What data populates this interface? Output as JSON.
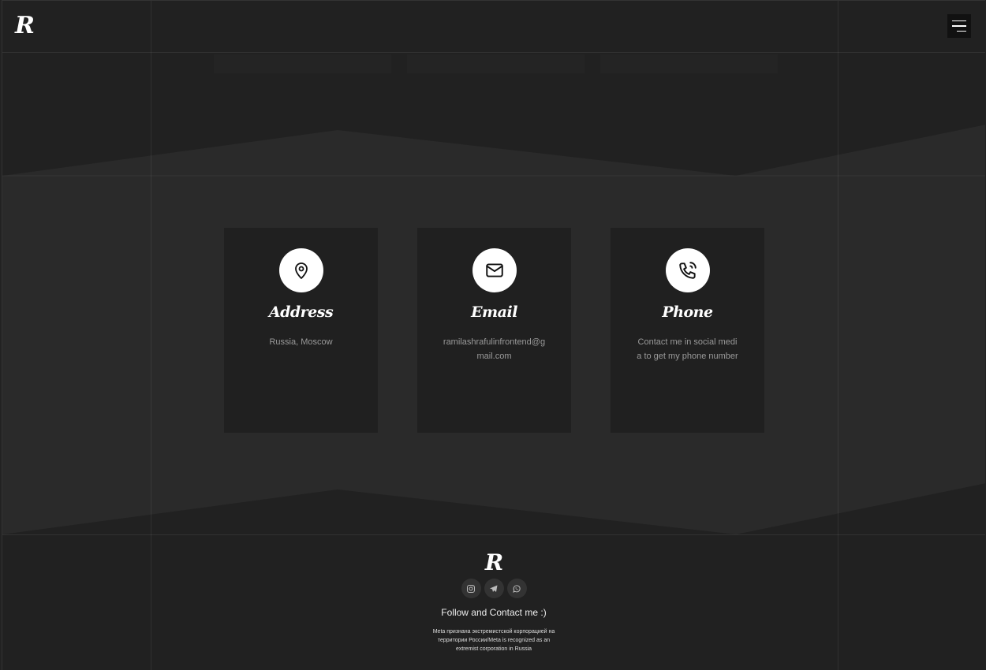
{
  "header": {
    "logo": "R",
    "menu_icon": "hamburger-icon"
  },
  "contact_cards": [
    {
      "icon": "map-pin-icon",
      "title": "Address",
      "text": "Russia, Moscow"
    },
    {
      "icon": "mail-icon",
      "title": "Email",
      "text": "ramilashrafulinfrontend@gmail.com"
    },
    {
      "icon": "phone-call-icon",
      "title": "Phone",
      "text": "Contact me in social media to get my phone number"
    }
  ],
  "footer": {
    "logo": "R",
    "socials": [
      {
        "icon": "instagram-icon"
      },
      {
        "icon": "telegram-icon"
      },
      {
        "icon": "whatsapp-icon"
      }
    ],
    "title": "Follow and Contact me :)",
    "note": "Meta признана экстремистской корпорацией на территории России/Meta is recognized as an extremist corporation in Russia"
  },
  "colors": {
    "background": "#212121",
    "section": "#2a2a2a",
    "card": "#202020",
    "icon_circle": "#ffffff",
    "text_muted": "#9a9a9a"
  }
}
